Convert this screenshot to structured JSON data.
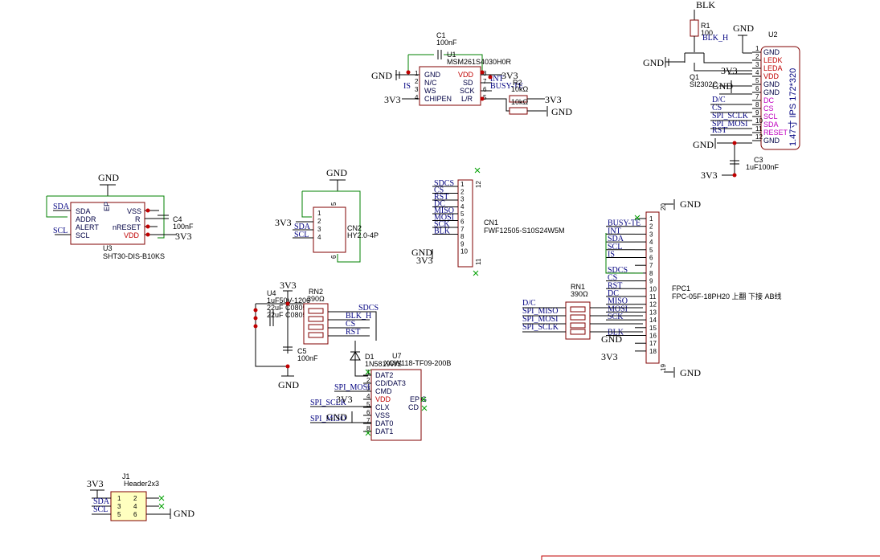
{
  "power": {
    "gnd": "GND",
    "v33": "3V3",
    "blk": "BLK"
  },
  "mic": {
    "cap_ref": "C1",
    "cap_val": "100nF",
    "ref": "U1",
    "part": "MSM261S4030H0R",
    "pins_left": [
      "GND",
      "N/C",
      "WS",
      "CHIPEN"
    ],
    "pins_right": [
      "VDD",
      "SD",
      "SCK",
      "L/R"
    ],
    "nums_left": [
      "1",
      "2",
      "3",
      "4"
    ],
    "nums_right": [
      "8",
      "7",
      "6",
      "5"
    ],
    "nets": [
      "INT",
      "BUSY-TE",
      "IS"
    ],
    "r_ref": "R2",
    "r_val": "10kΩ",
    "r2_val": "10kΩ"
  },
  "backlight": {
    "r_ref": "R1",
    "r_val": "100",
    "net": "BLK_H",
    "q_ref": "Q1",
    "q_part": "SI2302C"
  },
  "lcd": {
    "ref": "U2",
    "title": "1.47寸 IPS 172*320",
    "pins": [
      "GND",
      "LEDK",
      "LEDA",
      "VDD",
      "GND",
      "GND",
      "DC",
      "CS",
      "SCL",
      "SDA",
      "RESET",
      "GND"
    ],
    "nets": [
      "D/C",
      "CS",
      "SPI_SCLK",
      "SPI_MOSI",
      "RST"
    ],
    "c_ref": "C3",
    "c_val": "1uF100nF"
  },
  "sht": {
    "ref": "U3",
    "part": "SHT30-DIS-B10KS",
    "pins_left": [
      "SDA",
      "ADDR",
      "ALERT",
      "SCL"
    ],
    "pins_right": [
      "VSS",
      "R",
      "nRESET",
      "VDD"
    ],
    "ep": "EP",
    "nets": [
      "SDA",
      "SCL"
    ],
    "c_ref": "C4",
    "c_val": "100nF"
  },
  "hy": {
    "ref": "CN2",
    "part": "HY2.0-4P",
    "nets": [
      "SDA",
      "SCL"
    ]
  },
  "fwf": {
    "ref": "CN1",
    "part": "FWF12505-S10S24W5M",
    "nets": [
      "SDCS",
      "CS",
      "RST",
      "DC",
      "MISO",
      "MOSI",
      "SCK",
      "BLK"
    ]
  },
  "fpc": {
    "ref": "FPC1",
    "part": "FPC-05F-18PH20 上翻 下接 AB线",
    "nets": [
      "BUSY-TE",
      "INT",
      "SDA",
      "SCL",
      "IS",
      "SDCS",
      "CS",
      "RST",
      "DC",
      "MISO",
      "MOSI",
      "SCK",
      "BLK"
    ],
    "rn_ref": "RN1",
    "rn_val": "390Ω",
    "left_nets": [
      "D/C",
      "SPI_MISO",
      "SPI_MOSI",
      "SPI_SCLK"
    ]
  },
  "ldo": {
    "ref": "U4",
    "caps": [
      "1uF50V-1206",
      "22uF C0805",
      "22uF C0805"
    ],
    "rn_ref": "RN2",
    "rn_val": "390Ω",
    "nets": [
      "SDCS",
      "BLK_H",
      "CS",
      "RST"
    ],
    "c_ref": "C5",
    "c_val": "100nF"
  },
  "sd": {
    "d_ref": "D1",
    "d_part": "1N5819WS",
    "ref": "U7",
    "part": "XCW118-TF09-200B",
    "pins": [
      "DAT2",
      "CD/DAT3",
      "CMD",
      "VDD",
      "CLX",
      "VSS",
      "DAT0",
      "DAT1"
    ],
    "nets": [
      "SPI_MOSI",
      "SPI_SCLK",
      "SPI_MISO"
    ],
    "ep": "EP",
    "g": "G",
    "cd": "CD"
  },
  "header": {
    "ref": "J1",
    "part": "Header2x3",
    "nets": [
      "SDA",
      "SCL"
    ]
  }
}
